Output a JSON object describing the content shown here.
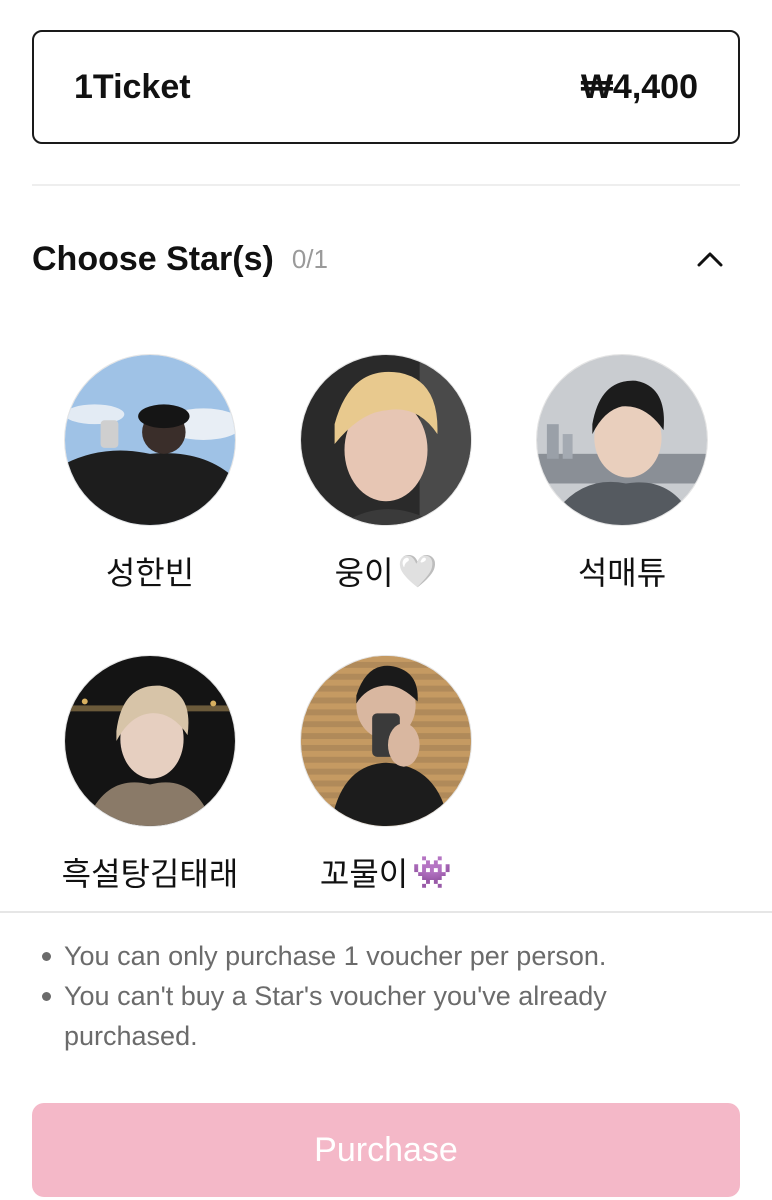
{
  "ticket": {
    "name": "1Ticket",
    "price": "₩4,400"
  },
  "choose": {
    "title": "Choose Star(s)",
    "count": "0/1",
    "toggle_icon": "chevron-up-icon"
  },
  "stars": [
    {
      "name": "성한빈",
      "emoji": ""
    },
    {
      "name": "웅이",
      "emoji": "🤍"
    },
    {
      "name": "석매튜",
      "emoji": ""
    },
    {
      "name": "흑설탕김태래",
      "emoji": ""
    },
    {
      "name": "꼬물이",
      "emoji": "👾"
    }
  ],
  "notes": [
    "You can only purchase 1 voucher per person.",
    "You can't buy a Star's voucher you've already purchased."
  ],
  "purchase": {
    "label": "Purchase"
  },
  "colors": {
    "purchase_bg": "#f4b8c8",
    "border": "#1a1a1a",
    "muted": "#9a9a9a"
  }
}
